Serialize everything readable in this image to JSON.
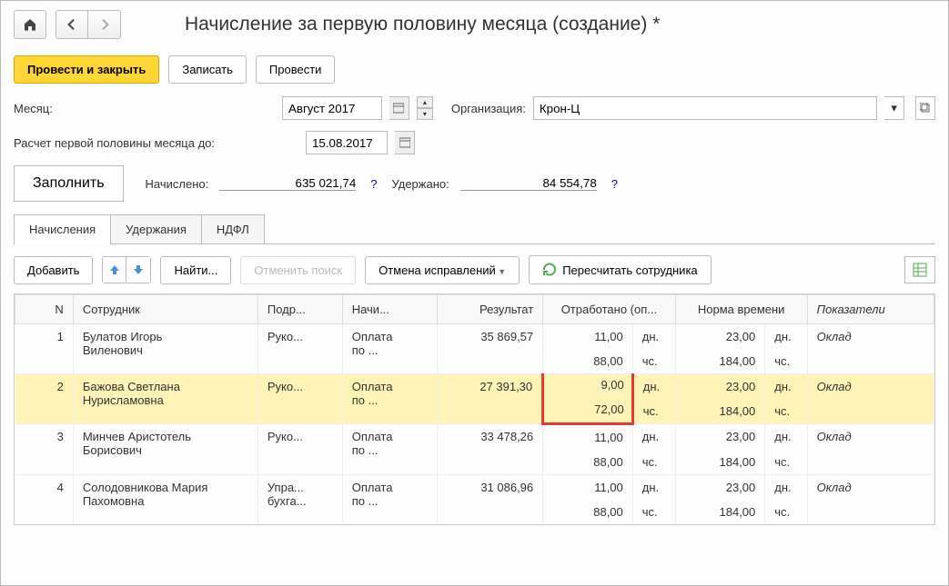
{
  "title": "Начисление за первую половину месяца (создание) *",
  "buttons": {
    "submit_close": "Провести и закрыть",
    "save": "Записать",
    "submit": "Провести",
    "fill": "Заполнить",
    "add": "Добавить",
    "find": "Найти...",
    "cancel_search": "Отменить поиск",
    "cancel_fixes": "Отмена исправлений",
    "recalc": "Пересчитать сотрудника"
  },
  "labels": {
    "month": "Месяц:",
    "organization": "Организация:",
    "calc_until": "Расчет первой половины месяца до:",
    "accrued": "Начислено:",
    "withheld": "Удержано:"
  },
  "fields": {
    "month_value": "Август 2017",
    "organization_value": "Крон-Ц",
    "calc_until_value": "15.08.2017",
    "accrued_value": "635 021,74",
    "withheld_value": "84 554,78"
  },
  "tabs": {
    "accruals": "Начисления",
    "withholdings": "Удержания",
    "ndfl": "НДФЛ"
  },
  "columns": {
    "n": "N",
    "employee": "Сотрудник",
    "department": "Подр...",
    "accrual_type": "Начи...",
    "result": "Результат",
    "worked": "Отработано (оп...",
    "norm": "Норма времени",
    "indicators": "Показатели"
  },
  "units": {
    "days": "дн.",
    "hours": "чс."
  },
  "rows": [
    {
      "n": "1",
      "employee": "Булатов Игорь Виленович",
      "department": "Руко...",
      "type": "Оплата по ...",
      "result": "35 869,57",
      "worked_days": "11,00",
      "worked_hours": "88,00",
      "norm_days": "23,00",
      "norm_hours": "184,00",
      "indicator": "Оклад",
      "selected": false,
      "highlighted": false
    },
    {
      "n": "2",
      "employee": "Бажова Светлана Нурисламовна",
      "department": "Руко...",
      "type": "Оплата по ...",
      "result": "27 391,30",
      "worked_days": "9,00",
      "worked_hours": "72,00",
      "norm_days": "23,00",
      "norm_hours": "184,00",
      "indicator": "Оклад",
      "selected": true,
      "highlighted": true
    },
    {
      "n": "3",
      "employee": "Минчев Аристотель Борисович",
      "department": "Руко...",
      "type": "Оплата по ...",
      "result": "33 478,26",
      "worked_days": "11,00",
      "worked_hours": "88,00",
      "norm_days": "23,00",
      "norm_hours": "184,00",
      "indicator": "Оклад",
      "selected": false,
      "highlighted": false
    },
    {
      "n": "4",
      "employee": "Солодовникова Мария Пахомовна",
      "department": "Упра... бухга...",
      "type": "Оплата по ...",
      "result": "31 086,96",
      "worked_days": "11,00",
      "worked_hours": "88,00",
      "norm_days": "23,00",
      "norm_hours": "184,00",
      "indicator": "Оклад",
      "selected": false,
      "highlighted": false
    }
  ]
}
